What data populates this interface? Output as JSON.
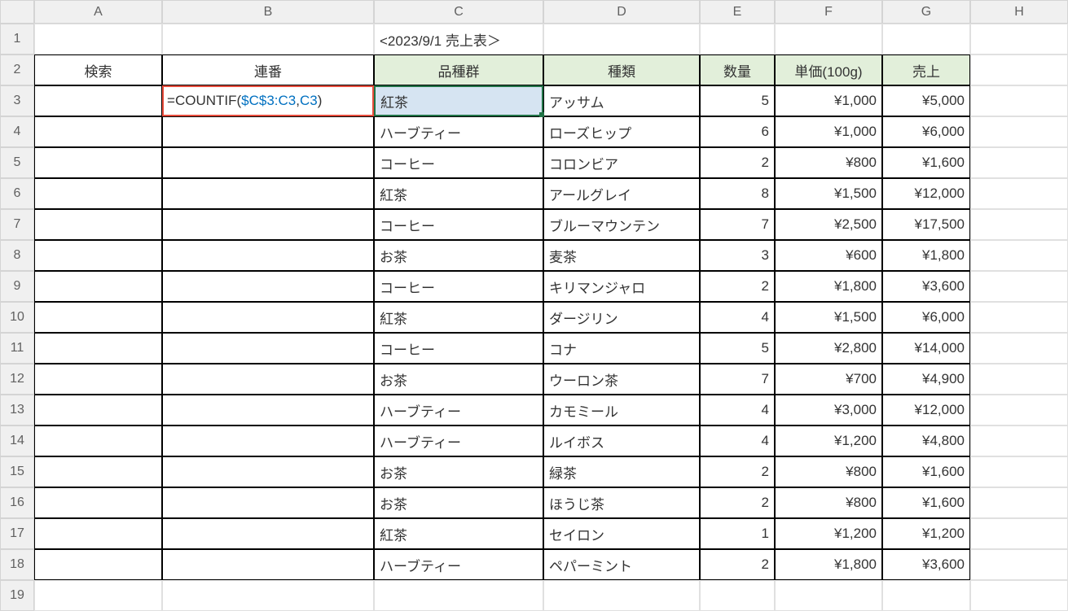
{
  "cols": [
    "",
    "A",
    "B",
    "C",
    "D",
    "E",
    "F",
    "G",
    "H"
  ],
  "rows": [
    "1",
    "2",
    "3",
    "4",
    "5",
    "6",
    "7",
    "8",
    "9",
    "10",
    "11",
    "12",
    "13",
    "14",
    "15",
    "16",
    "17",
    "18",
    "19"
  ],
  "title": "<2023/9/1 売上表＞",
  "h": {
    "a": "検索",
    "b": "連番",
    "c": "品種群",
    "d": "種類",
    "e": "数量",
    "f": "単価(100g)",
    "g": "売上"
  },
  "formula": {
    "pre": "=COUNTIF(",
    "ref1": "$C$3:C3",
    "comma": ",",
    "ref2": "C3",
    "post": ")"
  },
  "data": [
    {
      "c": "紅茶",
      "d": "アッサム",
      "e": "5",
      "f": "¥1,000",
      "g": "¥5,000"
    },
    {
      "c": "ハーブティー",
      "d": "ローズヒップ",
      "e": "6",
      "f": "¥1,000",
      "g": "¥6,000"
    },
    {
      "c": "コーヒー",
      "d": "コロンビア",
      "e": "2",
      "f": "¥800",
      "g": "¥1,600"
    },
    {
      "c": "紅茶",
      "d": "アールグレイ",
      "e": "8",
      "f": "¥1,500",
      "g": "¥12,000"
    },
    {
      "c": "コーヒー",
      "d": "ブルーマウンテン",
      "e": "7",
      "f": "¥2,500",
      "g": "¥17,500"
    },
    {
      "c": "お茶",
      "d": "麦茶",
      "e": "3",
      "f": "¥600",
      "g": "¥1,800"
    },
    {
      "c": "コーヒー",
      "d": "キリマンジャロ",
      "e": "2",
      "f": "¥1,800",
      "g": "¥3,600"
    },
    {
      "c": "紅茶",
      "d": "ダージリン",
      "e": "4",
      "f": "¥1,500",
      "g": "¥6,000"
    },
    {
      "c": "コーヒー",
      "d": "コナ",
      "e": "5",
      "f": "¥2,800",
      "g": "¥14,000"
    },
    {
      "c": "お茶",
      "d": "ウーロン茶",
      "e": "7",
      "f": "¥700",
      "g": "¥4,900"
    },
    {
      "c": "ハーブティー",
      "d": "カモミール",
      "e": "4",
      "f": "¥3,000",
      "g": "¥12,000"
    },
    {
      "c": "ハーブティー",
      "d": "ルイボス",
      "e": "4",
      "f": "¥1,200",
      "g": "¥4,800"
    },
    {
      "c": "お茶",
      "d": "緑茶",
      "e": "2",
      "f": "¥800",
      "g": "¥1,600"
    },
    {
      "c": "お茶",
      "d": "ほうじ茶",
      "e": "2",
      "f": "¥800",
      "g": "¥1,600"
    },
    {
      "c": "紅茶",
      "d": "セイロン",
      "e": "1",
      "f": "¥1,200",
      "g": "¥1,200"
    },
    {
      "c": "ハーブティー",
      "d": "ペパーミント",
      "e": "2",
      "f": "¥1,800",
      "g": "¥3,600"
    }
  ]
}
